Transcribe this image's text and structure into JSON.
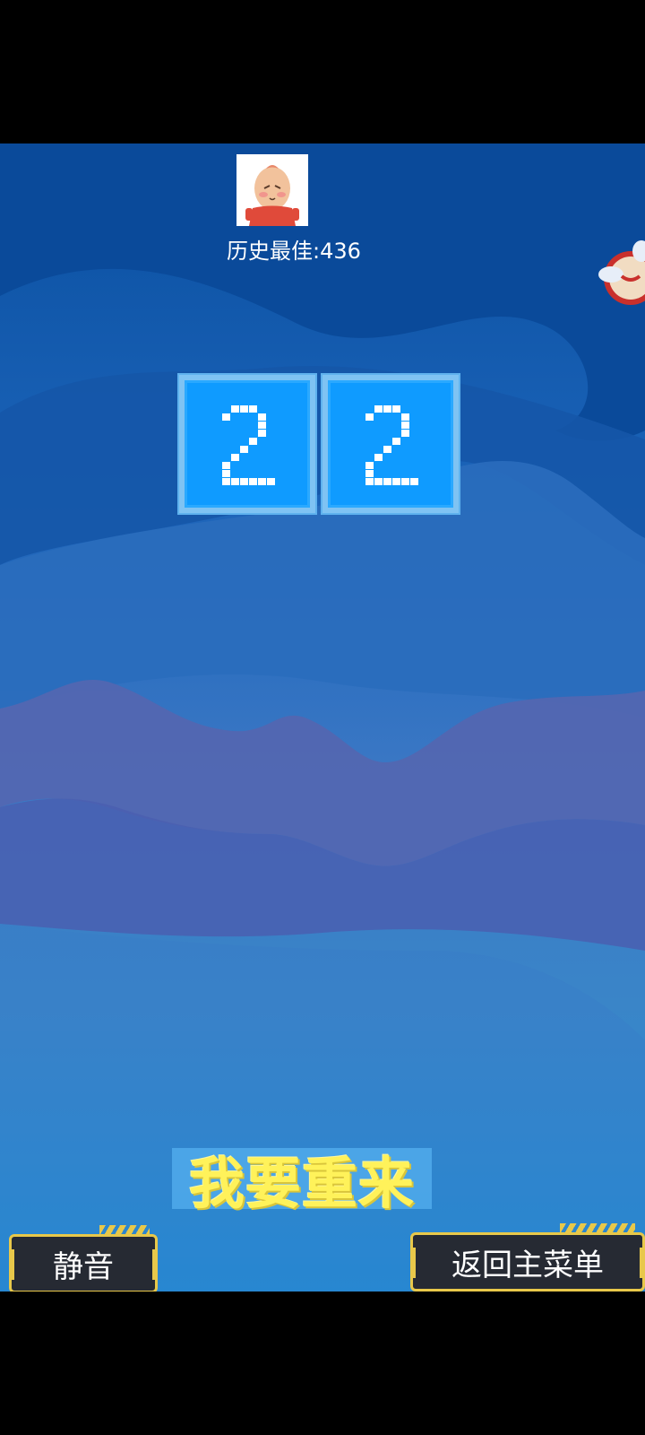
{
  "player": {
    "avatar": "sausage-character-avatar",
    "best_score_label": "历史最佳:436"
  },
  "score": {
    "digits": [
      "2",
      "2"
    ],
    "value": 22
  },
  "buttons": {
    "restart_label": "我要重来",
    "mute_label": "静音",
    "main_menu_label": "返回主菜单"
  },
  "colors": {
    "tile_fill": "#0f9bff",
    "tile_border": "#7fc3f3",
    "restart_text": "#fff25a",
    "button_border": "#e8c84a",
    "button_fill": "#262a33"
  }
}
